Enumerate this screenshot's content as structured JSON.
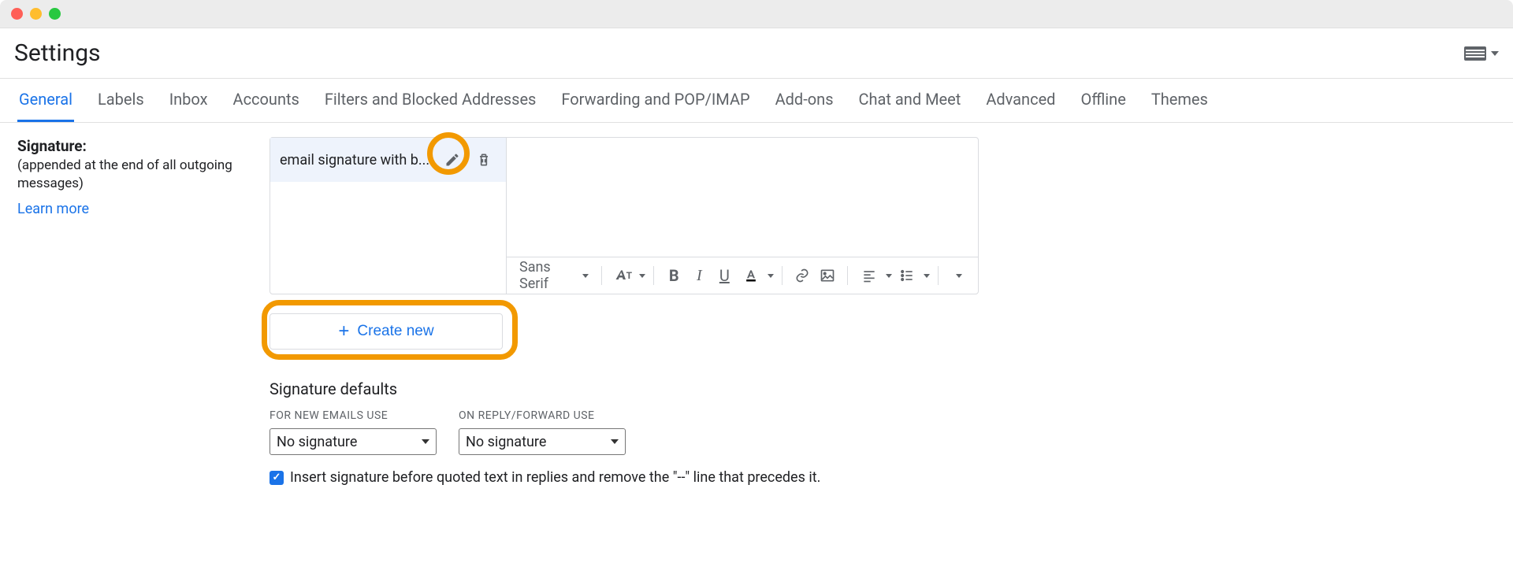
{
  "header": {
    "title": "Settings"
  },
  "tabs": [
    {
      "label": "General",
      "active": true
    },
    {
      "label": "Labels"
    },
    {
      "label": "Inbox"
    },
    {
      "label": "Accounts"
    },
    {
      "label": "Filters and Blocked Addresses"
    },
    {
      "label": "Forwarding and POP/IMAP"
    },
    {
      "label": "Add-ons"
    },
    {
      "label": "Chat and Meet"
    },
    {
      "label": "Advanced"
    },
    {
      "label": "Offline"
    },
    {
      "label": "Themes"
    }
  ],
  "signature": {
    "label": "Signature:",
    "sublabel": "(appended at the end of all outgoing messages)",
    "learn_more": "Learn more",
    "items": [
      {
        "name": "email signature with b..."
      }
    ],
    "create_label": "Create new",
    "toolbar_font": "Sans Serif"
  },
  "defaults": {
    "heading": "Signature defaults",
    "for_new_label": "FOR NEW EMAILS USE",
    "for_new_value": "No signature",
    "on_reply_label": "ON REPLY/FORWARD USE",
    "on_reply_value": "No signature",
    "insert_checkbox_label": "Insert signature before quoted text in replies and remove the \"--\" line that precedes it."
  }
}
